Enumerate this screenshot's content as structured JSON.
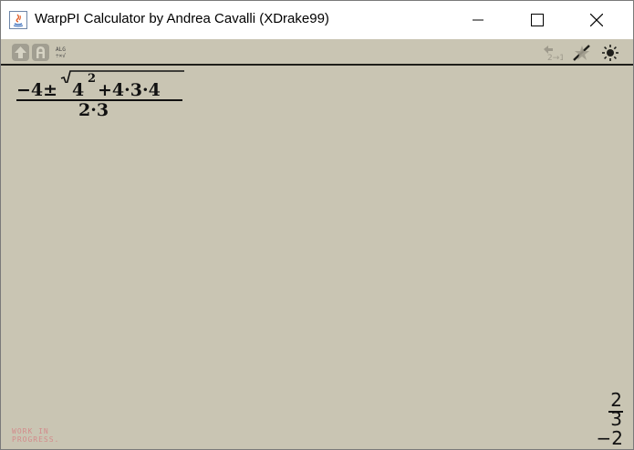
{
  "window": {
    "title": "WarpPI Calculator by Andrea Cavalli (XDrake99)",
    "controls": {
      "minimize": "minimize-icon",
      "maximize": "maximize-icon",
      "close": "close-icon"
    }
  },
  "statusbar": {
    "icons": [
      "shift-icon",
      "alpha-icon",
      "mode-icon",
      "undo-icon",
      "decimal-icon",
      "brightness-icon"
    ],
    "mode_top": "ALG",
    "mode_bottom": "÷×√",
    "undo_label": "2→1"
  },
  "expression": {
    "numerator_lead": "−4±",
    "radicand_base": "4",
    "radicand_exponent": "2",
    "radicand_rest": "+4·3·4",
    "denominator": "2·3"
  },
  "results": {
    "first_numerator": "2",
    "first_denominator": "3",
    "second": "−2"
  },
  "footer": {
    "line1": "WORK IN",
    "line2": "PROGRESS."
  },
  "colors": {
    "background": "#c9c5b3",
    "text": "#111111",
    "wip": "#d38b8b"
  }
}
